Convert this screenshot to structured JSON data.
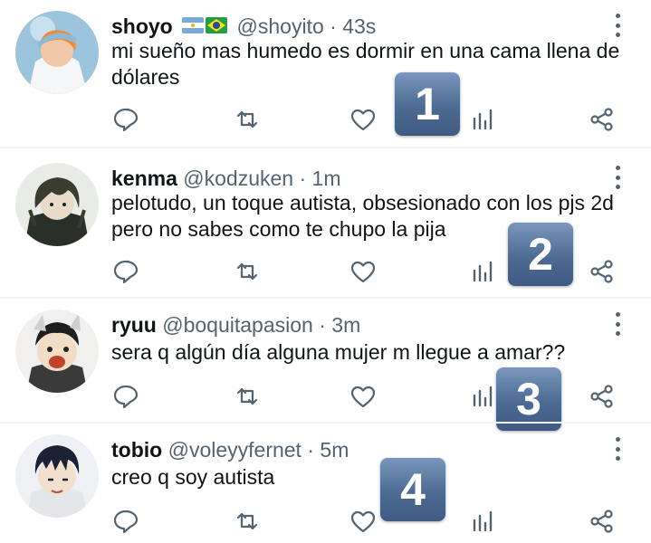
{
  "tweets": [
    {
      "name": "shoyo",
      "flags": [
        "argentina-flag",
        "brazil-flag"
      ],
      "handle": "@shoyito",
      "separator": "·",
      "time": "43s",
      "text": "mi sueño mas humedo es dormir en una cama llena de dólares",
      "badge": "1"
    },
    {
      "name": "kenma",
      "handle": "@kodzuken",
      "separator": "·",
      "time": "1m",
      "text": "pelotudo, un toque autista, obsesionado con los pjs 2d pero no sabes como te chupo la pija",
      "badge": "2"
    },
    {
      "name": "ryuu",
      "handle": "@boquitapasion",
      "separator": "·",
      "time": "3m",
      "text": "sera q algún día alguna mujer m llegue a amar??",
      "badge": "3"
    },
    {
      "name": "tobio",
      "handle": "@voleyyfernet",
      "separator": "·",
      "time": "5m",
      "text": "creo q soy autista",
      "badge": "4"
    }
  ],
  "action_icons": [
    "reply-icon",
    "retweet-icon",
    "like-icon",
    "analytics-icon",
    "share-icon"
  ],
  "colors": {
    "icon": "#536471",
    "badge": "#5b779f",
    "divider": "#eff3f4"
  }
}
